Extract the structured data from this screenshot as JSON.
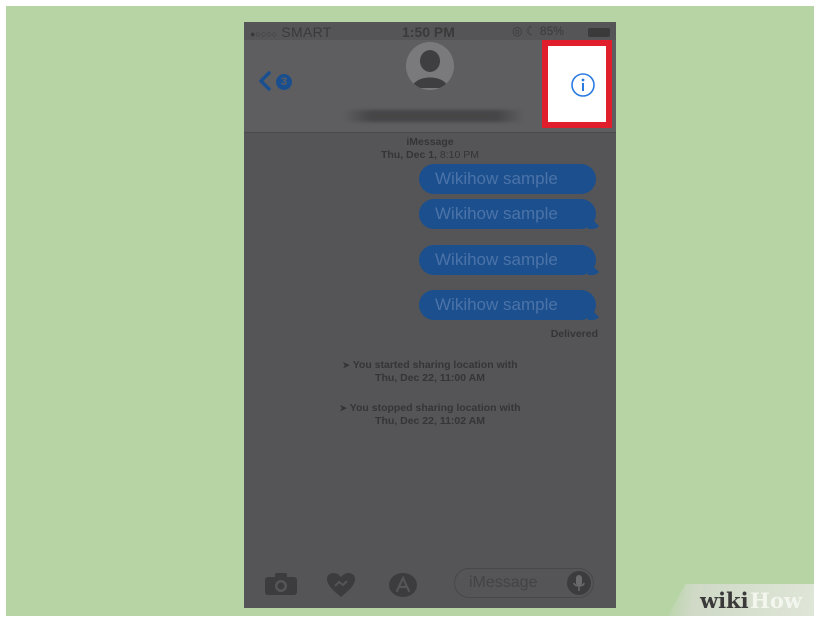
{
  "status_bar": {
    "signal_dots": "●○○○○",
    "carrier": "SMART",
    "time": "1:50 PM",
    "battery": "85%"
  },
  "nav": {
    "back_count": "3",
    "contact_name": ""
  },
  "thread": {
    "service": "iMessage",
    "date_bold": "Thu, Dec 1,",
    "date_time": "8:10 PM",
    "messages": [
      "Wikihow sample",
      "Wikihow sample",
      "Wikihow sample",
      "Wikihow sample"
    ],
    "delivered": "Delivered",
    "events": [
      {
        "line1": "You started sharing location with",
        "line2": "Thu, Dec 22, 11:00 AM"
      },
      {
        "line1": "You stopped sharing location with",
        "line2": "Thu, Dec 22, 11:02 AM"
      }
    ]
  },
  "composer": {
    "placeholder": "iMessage"
  },
  "watermark": {
    "part1": "wiki",
    "part2": "How"
  },
  "colors": {
    "background": "#b7d4a5",
    "highlight_border": "#e01e2c",
    "info_icon": "#2a7ae2",
    "bubble": "#1c4f8d"
  },
  "icons": [
    "chevron-left-icon",
    "person-icon",
    "info-icon",
    "camera-icon",
    "heart-hands-icon",
    "app-store-icon",
    "microphone-icon",
    "location-arrow-icon"
  ]
}
